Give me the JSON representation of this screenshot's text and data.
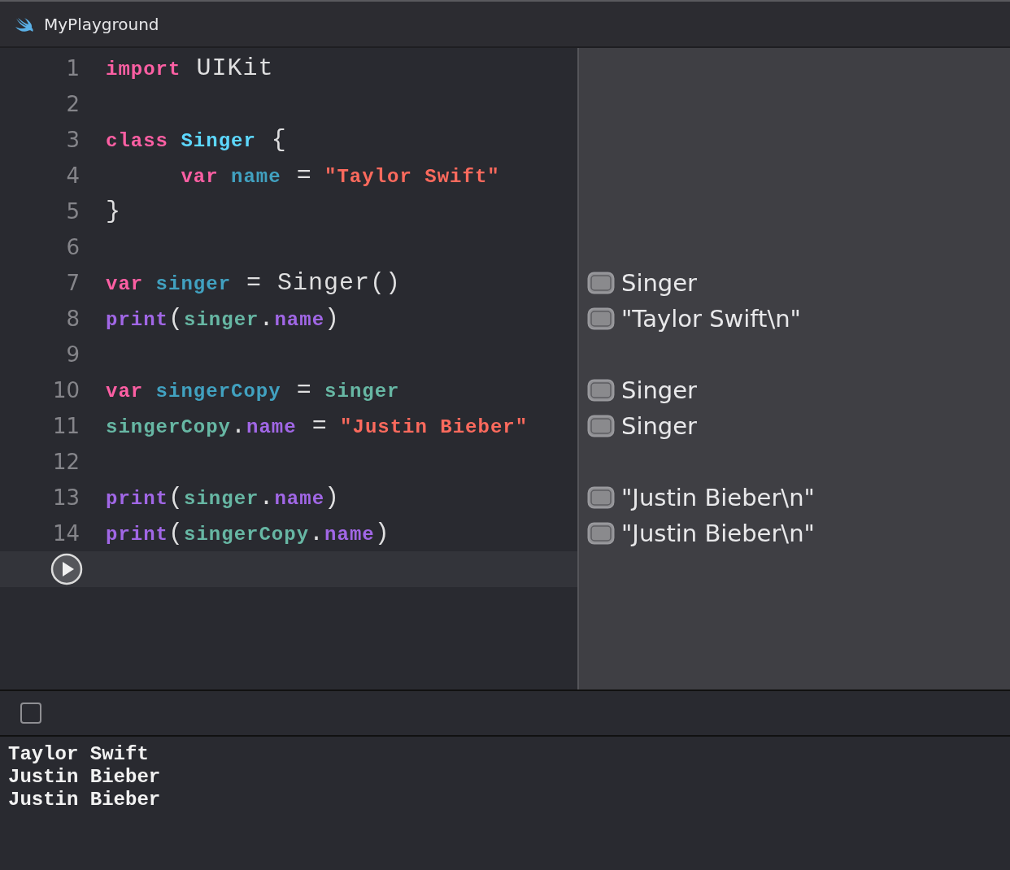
{
  "window": {
    "title": "MyPlayground"
  },
  "editor": {
    "lines": [
      {
        "number": "1",
        "tokens": [
          {
            "kind": "keyword",
            "text": "import"
          },
          {
            "kind": "plain",
            "text": " UIKit"
          }
        ]
      },
      {
        "number": "2"
      },
      {
        "number": "3",
        "tokens": [
          {
            "kind": "keyword",
            "text": "class"
          },
          {
            "kind": "typedecl",
            "text": " Singer"
          },
          {
            "kind": "plain",
            "text": " {"
          }
        ]
      },
      {
        "number": "4",
        "tokens": [
          {
            "kind": "keyword",
            "text": "      var"
          },
          {
            "kind": "decl",
            "text": " name"
          },
          {
            "kind": "plain",
            "text": " ="
          },
          {
            "kind": "string",
            "text": " \"Taylor Swift\""
          }
        ]
      },
      {
        "number": "5",
        "tokens": [
          {
            "kind": "plain",
            "text": "}"
          }
        ]
      },
      {
        "number": "6"
      },
      {
        "number": "7",
        "tokens": [
          {
            "kind": "keyword",
            "text": "var"
          },
          {
            "kind": "decl",
            "text": " singer"
          },
          {
            "kind": "plain",
            "text": " = Singer()"
          }
        ],
        "result": "Singer"
      },
      {
        "number": "8",
        "tokens": [
          {
            "kind": "func",
            "text": "print"
          },
          {
            "kind": "plain",
            "text": "("
          },
          {
            "kind": "ident",
            "text": "singer"
          },
          {
            "kind": "plain",
            "text": "."
          },
          {
            "kind": "func",
            "text": "name"
          },
          {
            "kind": "plain",
            "text": ")"
          }
        ],
        "result": "\"Taylor Swift\\n\""
      },
      {
        "number": "9"
      },
      {
        "number": "10",
        "tokens": [
          {
            "kind": "keyword",
            "text": "var"
          },
          {
            "kind": "decl",
            "text": " singerCopy"
          },
          {
            "kind": "plain",
            "text": " ="
          },
          {
            "kind": "ident",
            "text": " singer"
          }
        ],
        "result": "Singer"
      },
      {
        "number": "11",
        "tokens": [
          {
            "kind": "ident",
            "text": "singerCopy"
          },
          {
            "kind": "plain",
            "text": "."
          },
          {
            "kind": "func",
            "text": "name"
          },
          {
            "kind": "plain",
            "text": " ="
          },
          {
            "kind": "string",
            "text": " \"Justin Bieber\""
          }
        ],
        "result": "Singer"
      },
      {
        "number": "12"
      },
      {
        "number": "13",
        "tokens": [
          {
            "kind": "func",
            "text": "print"
          },
          {
            "kind": "plain",
            "text": "("
          },
          {
            "kind": "ident",
            "text": "singer"
          },
          {
            "kind": "plain",
            "text": "."
          },
          {
            "kind": "func",
            "text": "name"
          },
          {
            "kind": "plain",
            "text": ")"
          }
        ],
        "result": "\"Justin Bieber\\n\""
      },
      {
        "number": "14",
        "tokens": [
          {
            "kind": "func",
            "text": "print"
          },
          {
            "kind": "plain",
            "text": "("
          },
          {
            "kind": "ident",
            "text": "singerCopy"
          },
          {
            "kind": "plain",
            "text": "."
          },
          {
            "kind": "func",
            "text": "name"
          },
          {
            "kind": "plain",
            "text": ")"
          }
        ],
        "result": "\"Justin Bieber\\n\""
      }
    ]
  },
  "console": {
    "lines": [
      "Taylor Swift",
      "Justin Bieber",
      "Justin Bieber"
    ]
  }
}
